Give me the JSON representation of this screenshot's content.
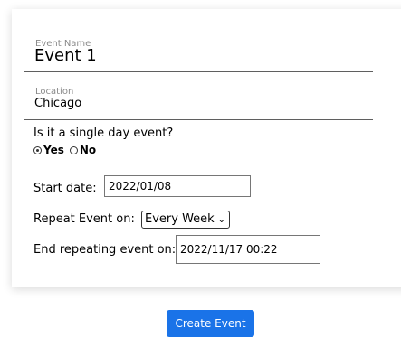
{
  "form": {
    "event_name": {
      "label": "Event Name",
      "value": "Event 1"
    },
    "location": {
      "label": "Location",
      "value": "Chicago"
    },
    "single_day": {
      "question": "Is it a single day event?",
      "yes_label": "Yes",
      "no_label": "No",
      "selected": "Yes"
    },
    "start_date": {
      "label": "Start date:",
      "value": "2022/01/08"
    },
    "repeat": {
      "label": "Repeat Event on:",
      "value": "Every Week"
    },
    "end_repeat": {
      "label": "End repeating event on:",
      "value": "2022/11/17 00:22"
    }
  },
  "actions": {
    "create_label": "Create Event"
  },
  "colors": {
    "primary_button": "#1a73e8"
  }
}
